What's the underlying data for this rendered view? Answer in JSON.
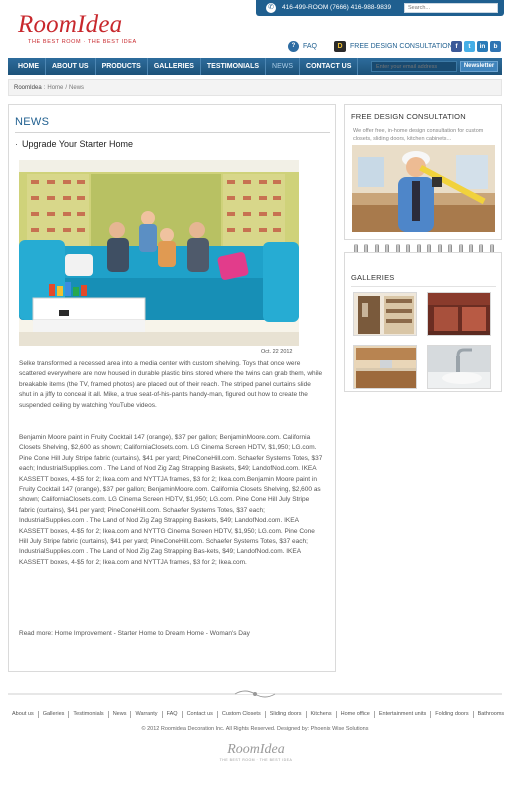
{
  "brand": {
    "name": "RoomIdea",
    "tagline": "THE BEST ROOM · THE BEST IDEA",
    "color": "#c8282d"
  },
  "topbar": {
    "phone": "416-499-ROOM (7666)  416-988-9839",
    "search_placeholder": "Search..."
  },
  "header_links": {
    "faq": "FAQ",
    "consultation": "FREE DESIGN CONSULTATION",
    "social": [
      {
        "icon": "facebook-icon",
        "glyph": "f",
        "color": "#3b5998"
      },
      {
        "icon": "twitter-icon",
        "glyph": "t",
        "color": "#45aee6"
      },
      {
        "icon": "linkedin-icon",
        "glyph": "in",
        "color": "#2a7bb8"
      },
      {
        "icon": "blog-icon",
        "glyph": "b",
        "color": "#2f74b3"
      }
    ]
  },
  "nav": {
    "items": [
      "HOME",
      "ABOUT US",
      "PRODUCTS",
      "GALLERIES",
      "TESTIMONIALS",
      "NEWS",
      "CONTACT US"
    ],
    "active": "NEWS",
    "newsletter_placeholder": "Enter your email address",
    "newsletter_button": "Newsletter"
  },
  "breadcrumb": {
    "site": "RoomIdea",
    "sep1": ":",
    "home": "Home",
    "sep2": "/",
    "current": "News"
  },
  "main": {
    "section_title": "NEWS",
    "bullet": "·",
    "article_title": "Upgrade Your Starter Home",
    "date": "Oct. 22 2012",
    "paragraph1": "Selke transformed a recessed area into a media center with custom shelving. Toys that once were scattered everywhere are now housed in durable plastic bins stored where the twins can grab them, while breakable items (the TV, framed photos) are placed out of their reach. The striped panel curtains slide shut in a jiffy to conceal it all. Mike, a true seat-of-his-pants handy-man, figured out how to create the suspended ceiling by watching YouTube videos.",
    "paragraph2": "Benjamin Moore paint in Fruity Cocktail 147 (orange), $37 per gallon; BenjaminMoore.com. California Closets Shelving, $2,600 as shown; CaliforniaClosets.com. LG Cinema Screen HDTV, $1,950; LG.com. Pine Cone Hill July Stripe fabric (curtains), $41 per yard; PineConeHill.com. Schaefer Systems Totes, $37 each; IndustrialSupplies.com . The Land of Nod Zig Zag Strapping Baskets, $49; LandofNod.com. IKEA KASSETT boxes, 4-$5 for 2; Ikea.com and NYTTJA frames, $3 for 2; Ikea.com.Benjamin Moore paint in Fruity Cocktail 147 (orange), $37 per gallon; BenjaminMoore.com. California Closets Shelving, $2,600 as shown; CaliforniaClosets.com. LG Cinema Screen HDTV, $1,950; LG.com. Pine Cone Hill July Stripe fabric (curtains), $41 per yard; PineConeHill.com. Schaefer Systems Totes, $37 each; IndustrialSupplies.com . The Land of Nod Zig Zag Strapping Baskets, $49; LandofNod.com. IKEA KASSETT boxes, 4-$5 for 2; Ikea.com and NYTTG Cinema Screen HDTV, $1,950; LG.com. Pine Cone Hill July Stripe fabric (curtains), $41 per yard; PineConeHill.com. Schaefer Systems Totes, $37 each; IndustrialSupplies.com . The Land of Nod Zig Zag Strapping Bas-kets, $49; LandofNod.com. IKEA KASSETT boxes, 4-$5 for 2; Ikea.com and NYTTJA frames, $3 for 2; Ikea.com.",
    "read_more": "Read more: Home Improvement - Starter Home to Dream Home - Woman's Day"
  },
  "sidebar": {
    "consult_title": "FREE DESIGN CONSULTATION",
    "consult_desc": "We offer free, in-home design consultation for custom closets, sliding doors, kitchen cabinets...",
    "galleries_title": "GALLERIES",
    "gallery_thumbs": [
      "closet-thumbnail",
      "sliding-door-thumbnail",
      "kitchen-thumbnail",
      "bathroom-thumbnail"
    ]
  },
  "footer": {
    "links": [
      "About us",
      "Galleries",
      "Testimonials",
      "News",
      "Warranty",
      "FAQ",
      "Contact us",
      "Custom Closets",
      "Sliding doors",
      "Kitchens",
      "Home office",
      "Entertainment units",
      "Folding doors",
      "Bathrooms"
    ],
    "copyright": "© 2012 Roomidea Decoration Inc. All Rights Reserved.   Designed by: Phoenix Wise Solutions",
    "logo": "RoomIdea",
    "logo_tagline": "THE BEST ROOM · THE BEST IDEA"
  },
  "colors": {
    "nav_blue": "#1f5f8f",
    "accent_red": "#c8282d"
  }
}
